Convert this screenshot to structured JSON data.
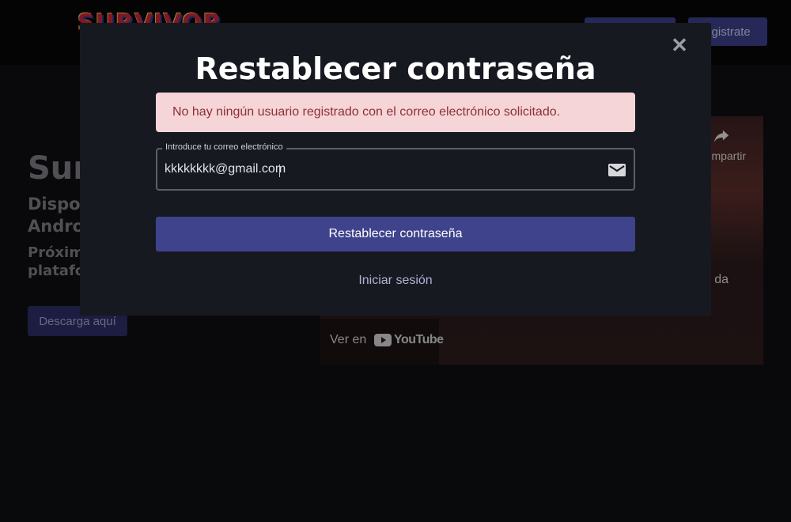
{
  "header": {
    "logo_text": "SURVIVOR",
    "login_label": "",
    "register_label": "egistrate"
  },
  "hero": {
    "title": "Surv",
    "subtitle": "Dispon\nAndro",
    "subtitle2": "Próxima\nplatafo",
    "download_label": "Descarga aquí"
  },
  "video": {
    "share_label": "mpartir",
    "side_text": "da",
    "watch_on": "Ver en",
    "youtube_label": "YouTube"
  },
  "modal": {
    "title": "Restablecer contraseña",
    "close_symbol": "✕",
    "alert": "No hay ningún usuario registrado con el correo electrónico solicitado.",
    "email_label": "Introduce tu correo electrónico",
    "email_value": "kkkkkkkk@gmail.com",
    "submit_label": "Restablecer contraseña",
    "login_link": "Iniciar sesión"
  },
  "icons": {
    "close": "close-icon",
    "mail": "mail-icon",
    "share": "share-icon",
    "youtube": "youtube-icon"
  },
  "colors": {
    "accent": "#3e438c",
    "alert_bg": "#f5d5d7",
    "alert_text": "#8e2f38",
    "modal_bg": "#171920"
  }
}
